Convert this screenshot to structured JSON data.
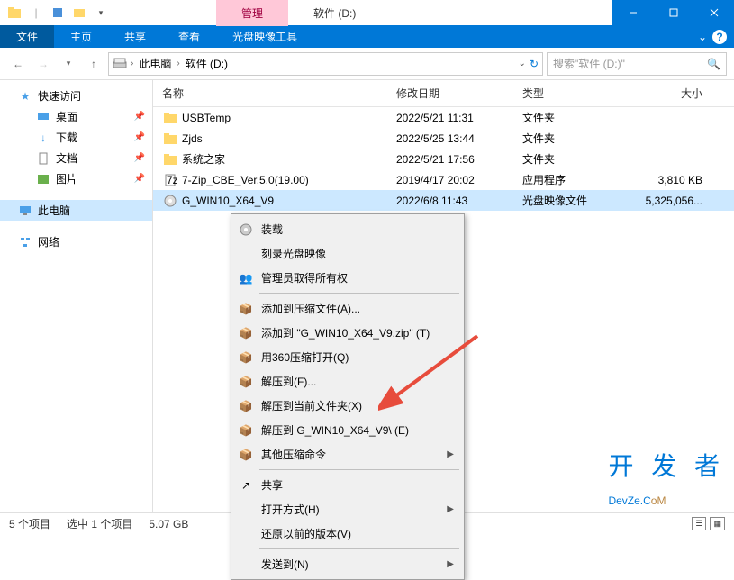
{
  "title_tabs": {
    "manage": "管理",
    "drive": "软件 (D:)"
  },
  "ribbon": {
    "file": "文件",
    "home": "主页",
    "share": "共享",
    "view": "查看",
    "disc_tool": "光盘映像工具"
  },
  "breadcrumb": {
    "pc": "此电脑",
    "drive": "软件 (D:)"
  },
  "search": {
    "placeholder": "搜索\"软件 (D:)\""
  },
  "sidebar": {
    "quick": "快速访问",
    "desktop": "桌面",
    "downloads": "下载",
    "documents": "文档",
    "pictures": "图片",
    "thispc": "此电脑",
    "network": "网络"
  },
  "columns": {
    "name": "名称",
    "date": "修改日期",
    "type": "类型",
    "size": "大小"
  },
  "files": [
    {
      "name": "USBTemp",
      "date": "2022/5/21 11:31",
      "type": "文件夹",
      "size": "",
      "icon": "folder"
    },
    {
      "name": "Zjds",
      "date": "2022/5/25 13:44",
      "type": "文件夹",
      "size": "",
      "icon": "folder"
    },
    {
      "name": "系统之家",
      "date": "2022/5/21 17:56",
      "type": "文件夹",
      "size": "",
      "icon": "folder"
    },
    {
      "name": "7-Zip_CBE_Ver.5.0(19.00)",
      "date": "2019/4/17 20:02",
      "type": "应用程序",
      "size": "3,810 KB",
      "icon": "exe"
    },
    {
      "name": "G_WIN10_X64_V9",
      "date": "2022/6/8 11:43",
      "type": "光盘映像文件",
      "size": "5,325,056...",
      "icon": "iso",
      "selected": true
    }
  ],
  "context": {
    "mount": "装载",
    "burn": "刻录光盘映像",
    "admin": "管理员取得所有权",
    "addzip": "添加到压缩文件(A)...",
    "addzipname": "添加到 \"G_WIN10_X64_V9.zip\" (T)",
    "open360": "用360压缩打开(Q)",
    "extractto": "解压到(F)...",
    "extracthere": "解压到当前文件夹(X)",
    "extractfolder": "解压到 G_WIN10_X64_V9\\ (E)",
    "othercomp": "其他压缩命令",
    "share": "共享",
    "openwith": "打开方式(H)",
    "restore": "还原以前的版本(V)",
    "sendto": "发送到(N)"
  },
  "status": {
    "count": "5 个项目",
    "selected": "选中 1 个项目",
    "size": "5.07 GB"
  },
  "watermark": {
    "line1": "开 发 者",
    "line2a": "DevZe.C",
    "line2b": "oM"
  }
}
